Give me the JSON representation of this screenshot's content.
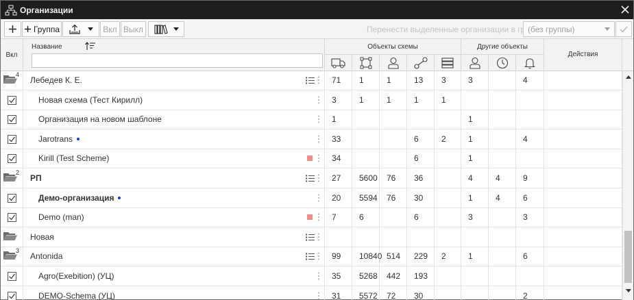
{
  "window": {
    "title": "Организации"
  },
  "toolbar": {
    "group_label": "Группа",
    "on_label": "Вкл",
    "off_label": "Выкл",
    "move_label": "Перенести выделенные организации в группу",
    "group_select_value": "(без группы)"
  },
  "header": {
    "enabled": "Вкл",
    "name": "Название",
    "name_filter_value": "",
    "scheme_objects": "Объекты схемы",
    "other_objects": "Другие объекты",
    "actions": "Действия"
  },
  "rows": [
    {
      "kind": "group",
      "name": "Лебедев К. Е.",
      "count": "4",
      "bold": false,
      "dot": false,
      "vals": [
        "71",
        "1",
        "1",
        "13",
        "3",
        "3",
        "",
        "4"
      ]
    },
    {
      "kind": "item",
      "name": "Новая схема (Тест Кирилл)",
      "bold": false,
      "dot": false,
      "red": false,
      "vals": [
        "3",
        "1",
        "1",
        "1",
        "1",
        "",
        "",
        ""
      ]
    },
    {
      "kind": "item",
      "name": "Организация на новом шаблоне",
      "bold": false,
      "dot": false,
      "red": false,
      "vals": [
        "1",
        "",
        "",
        "",
        "",
        "1",
        "",
        ""
      ]
    },
    {
      "kind": "item",
      "name": "Jarotrans",
      "bold": false,
      "dot": true,
      "red": false,
      "vals": [
        "33",
        "",
        "",
        "6",
        "2",
        "1",
        "",
        "4"
      ]
    },
    {
      "kind": "item",
      "name": "Kirill (Test Scheme)",
      "bold": false,
      "dot": false,
      "red": true,
      "vals": [
        "34",
        "",
        "",
        "6",
        "",
        "1",
        "",
        ""
      ]
    },
    {
      "kind": "group",
      "name": "РП",
      "count": "2",
      "bold": true,
      "dot": false,
      "vals": [
        "27",
        "5600",
        "76",
        "36",
        "",
        "4",
        "4",
        "9"
      ]
    },
    {
      "kind": "item",
      "name": "Демо-организация",
      "bold": true,
      "dot": true,
      "red": false,
      "vals": [
        "20",
        "5594",
        "76",
        "30",
        "",
        "1",
        "4",
        "6"
      ]
    },
    {
      "kind": "item",
      "name": "Demo (man)",
      "bold": false,
      "dot": false,
      "red": true,
      "vals": [
        "7",
        "6",
        "",
        "6",
        "",
        "3",
        "",
        "3"
      ]
    },
    {
      "kind": "group",
      "name": "Новая",
      "count": "",
      "bold": false,
      "dot": false,
      "vals": [
        "",
        "",
        "",
        "",
        "",
        "",
        "",
        ""
      ]
    },
    {
      "kind": "group",
      "name": "Antonida",
      "count": "3",
      "bold": false,
      "dot": false,
      "vals": [
        "99",
        "10840",
        "514",
        "229",
        "2",
        "1",
        "",
        "6"
      ]
    },
    {
      "kind": "item",
      "name": "Agro(Exebition) (УЦ)",
      "bold": false,
      "dot": false,
      "red": false,
      "vals": [
        "35",
        "5268",
        "442",
        "193",
        "",
        "",
        "",
        ""
      ]
    },
    {
      "kind": "item",
      "name": "DEMO-Schema (УЦ)",
      "bold": false,
      "dot": false,
      "red": false,
      "vals": [
        "31",
        "5572",
        "72",
        "30",
        "",
        "",
        "",
        "2"
      ]
    }
  ]
}
